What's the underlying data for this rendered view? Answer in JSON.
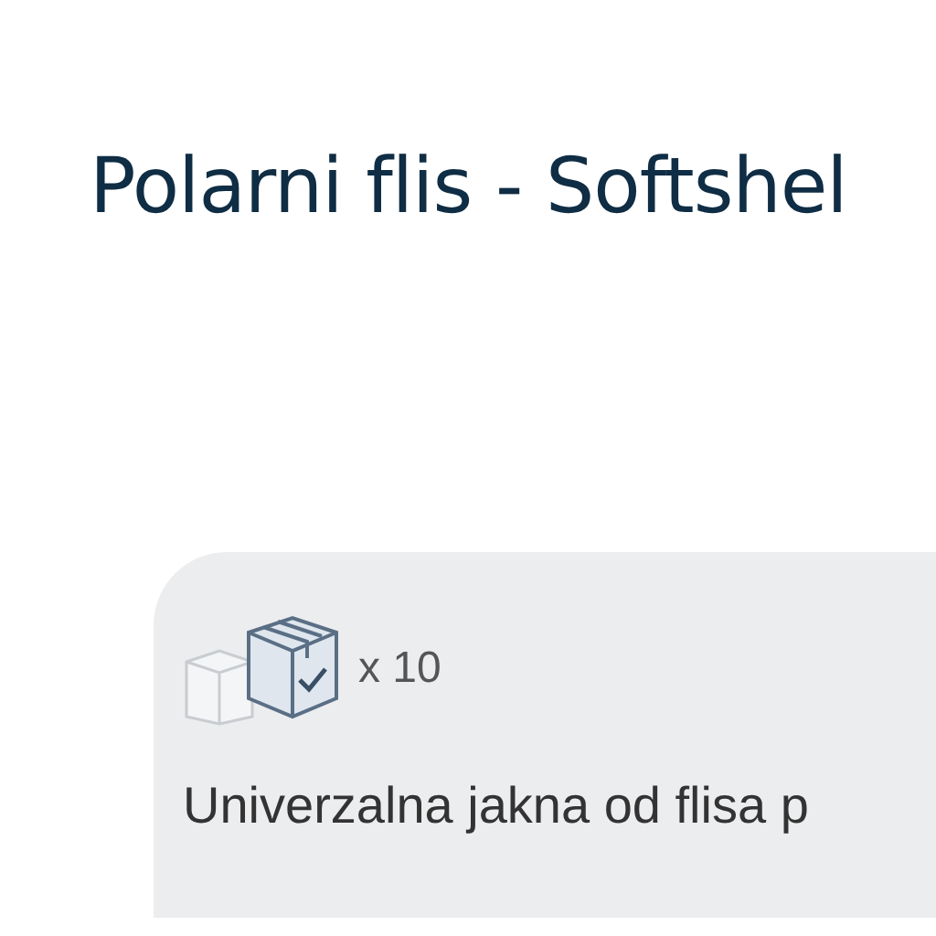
{
  "title": "Polarni flis - Softshel",
  "card": {
    "quantity": "x 10",
    "description": "Univerzalna jakna od flisa p"
  }
}
